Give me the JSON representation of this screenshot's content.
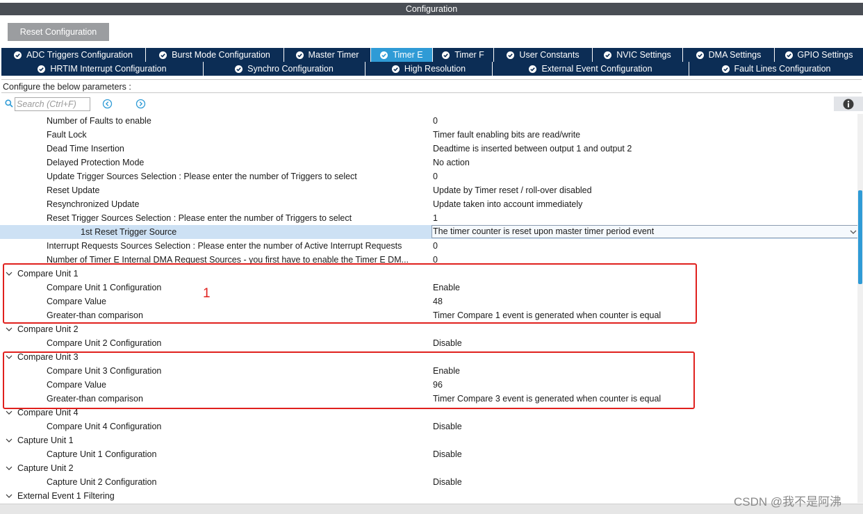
{
  "window": {
    "title": "Configuration"
  },
  "toolbar": {
    "reset_label": "Reset Configuration"
  },
  "tabs_row1": [
    {
      "label": "ADC Triggers Configuration",
      "active": false
    },
    {
      "label": "Burst Mode Configuration",
      "active": false
    },
    {
      "label": "Master Timer",
      "active": false
    },
    {
      "label": "Timer E",
      "active": true
    },
    {
      "label": "Timer F",
      "active": false
    },
    {
      "label": "User Constants",
      "active": false
    },
    {
      "label": "NVIC Settings",
      "active": false
    },
    {
      "label": "DMA Settings",
      "active": false
    },
    {
      "label": "GPIO Settings",
      "active": false
    }
  ],
  "tabs_row2": [
    {
      "label": "HRTIM Interrupt Configuration"
    },
    {
      "label": "Synchro Configuration"
    },
    {
      "label": "High Resolution"
    },
    {
      "label": "External Event Configuration"
    },
    {
      "label": "Fault Lines Configuration"
    }
  ],
  "params_hint": "Configure the below parameters :",
  "search": {
    "placeholder": "Search (Ctrl+F)"
  },
  "icons": {
    "search": "search-icon",
    "prev": "chevron-left-circle-icon",
    "next": "chevron-right-circle-icon",
    "info": "info-icon",
    "expand": "chevron-down-icon",
    "check": "check-circle-icon"
  },
  "params": [
    {
      "label": "Number of Faults to enable",
      "value": "0"
    },
    {
      "label": "Fault Lock",
      "value": "Timer fault enabling bits are read/write"
    },
    {
      "label": "Dead Time Insertion",
      "value": "Deadtime is inserted between output 1 and output 2"
    },
    {
      "label": "Delayed Protection Mode",
      "value": "No action"
    },
    {
      "label": "Update Trigger Sources Selection : Please enter the number of Triggers to select",
      "value": "0"
    },
    {
      "label": "Reset Update",
      "value": "Update by Timer reset / roll-over disabled"
    },
    {
      "label": "Resynchronized Update",
      "value": "Update taken into account immediately"
    },
    {
      "label": "Reset Trigger Sources Selection : Please enter the number of Triggers to select",
      "value": "1"
    },
    {
      "label": "1st Reset Trigger Source",
      "value": "The timer counter is reset upon master timer period event",
      "selected": true
    },
    {
      "label": "Interrupt Requests Sources Selection : Please enter the number of Active Interrupt Requests",
      "value": "0"
    },
    {
      "label": "Number of Timer E Internal DMA Request Sources - you first have to enable the Timer E DM...",
      "value": "0"
    },
    {
      "group": "Compare Unit 1"
    },
    {
      "label": "Compare Unit 1 Configuration",
      "value": "Enable"
    },
    {
      "label": "Compare Value",
      "value": "48"
    },
    {
      "label": "Greater-than comparison",
      "value": "Timer Compare 1 event is generated when counter is equal"
    },
    {
      "group": "Compare Unit 2"
    },
    {
      "label": "Compare Unit 2 Configuration",
      "value": "Disable"
    },
    {
      "group": "Compare Unit 3"
    },
    {
      "label": "Compare Unit 3 Configuration",
      "value": "Enable"
    },
    {
      "label": "Compare Value",
      "value": "96"
    },
    {
      "label": "Greater-than comparison",
      "value": "Timer Compare 3 event is generated when counter is equal"
    },
    {
      "group": "Compare Unit 4"
    },
    {
      "label": "Compare Unit 4 Configuration",
      "value": "Disable"
    },
    {
      "group": "Capture Unit 1"
    },
    {
      "label": "Capture Unit 1 Configuration",
      "value": "Disable"
    },
    {
      "group": "Capture Unit 2"
    },
    {
      "label": "Capture Unit 2 Configuration",
      "value": "Disable"
    },
    {
      "group": "External Event 1 Filtering"
    }
  ],
  "annotation": {
    "number": "1",
    "color": "#e0201d"
  },
  "watermark": "CSDN @我不是阿沸",
  "colors": {
    "tab_bg": "#0c2d55",
    "tab_active": "#2f9bd6",
    "selected_row": "#cde1f4",
    "title_bar": "#4a4e55"
  }
}
